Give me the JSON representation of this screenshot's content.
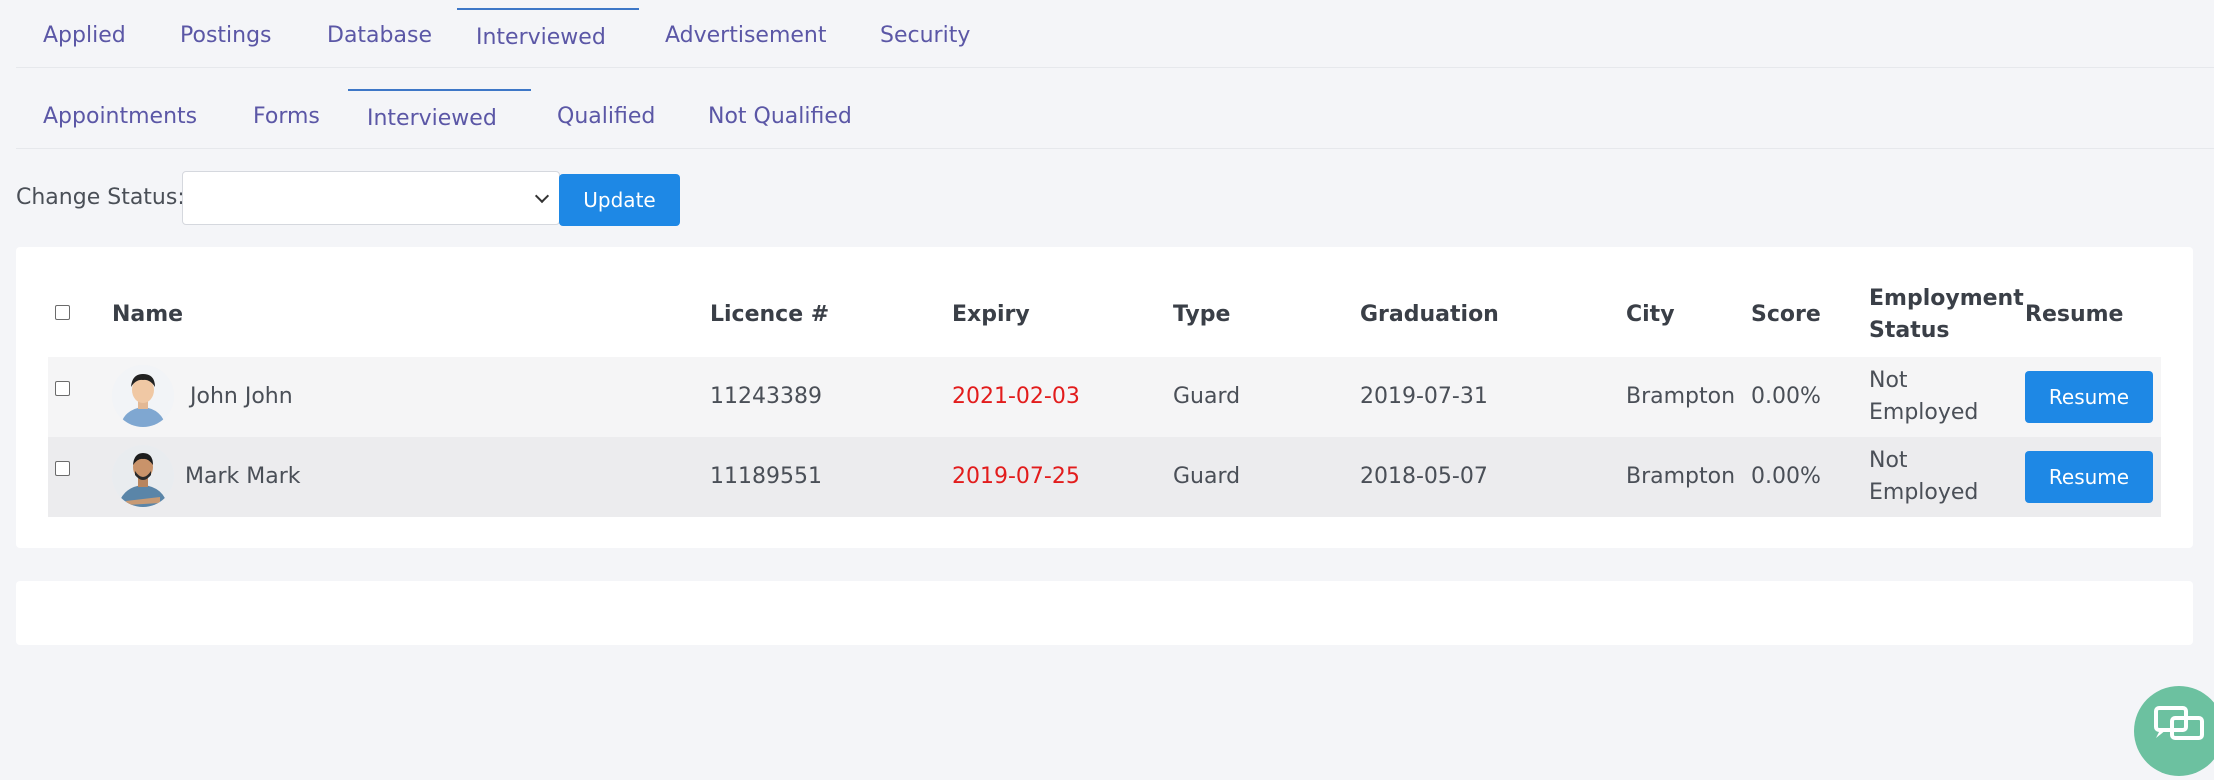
{
  "primary_tabs": [
    {
      "label": "Applied"
    },
    {
      "label": "Postings"
    },
    {
      "label": "Database"
    },
    {
      "label": "Interviewed"
    },
    {
      "label": "Advertisement"
    },
    {
      "label": "Security"
    }
  ],
  "primary_active": "Interviewed",
  "secondary_tabs": [
    {
      "label": "Appointments"
    },
    {
      "label": "Forms"
    },
    {
      "label": "Interviewed"
    },
    {
      "label": "Qualified"
    },
    {
      "label": "Not Qualified"
    }
  ],
  "secondary_active": "Interviewed",
  "status": {
    "label": "Change Status:",
    "selected": "",
    "update_label": "Update"
  },
  "table": {
    "headers": {
      "name": "Name",
      "licence": "Licence #",
      "expiry": "Expiry",
      "type": "Type",
      "graduation": "Graduation",
      "city": "City",
      "score": "Score",
      "employment_line1": "Employment",
      "employment_line2": "Status",
      "resume": "Resume"
    },
    "rows": [
      {
        "name": "John John",
        "licence": "11243389",
        "expiry": "2021-02-03",
        "type": "Guard",
        "graduation": "2019-07-31",
        "city": "Brampton",
        "score": "0.00%",
        "employment_line1": "Not",
        "employment_line2": "Employed",
        "resume_label": "Resume"
      },
      {
        "name": "Mark Mark",
        "licence": "11189551",
        "expiry": "2019-07-25",
        "type": "Guard",
        "graduation": "2018-05-07",
        "city": "Brampton",
        "score": "0.00%",
        "employment_line1": "Not",
        "employment_line2": "Employed",
        "resume_label": "Resume"
      }
    ]
  },
  "colors": {
    "tab_text": "#5b57a6",
    "active_tab_border": "#3d77c7",
    "button": "#1e88e5",
    "expiry_text": "#e21c1c",
    "chat_fab": "#6cc1a0"
  },
  "icons": [
    "chevron-down-icon",
    "checkbox-icon",
    "avatar",
    "chat-icon"
  ]
}
